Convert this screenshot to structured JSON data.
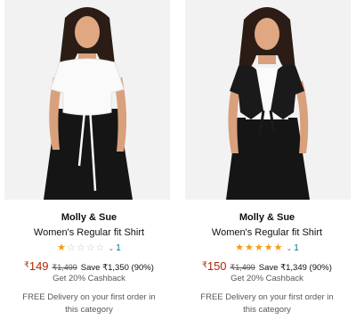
{
  "products": [
    {
      "brand": "Molly & Sue",
      "title": "Women's Regular fit Shirt",
      "rating_stars": 1,
      "rating_max": 5,
      "rating_count": "1",
      "currency_symbol": "₹",
      "price": "149",
      "mrp": "₹1,499",
      "save": "Save ₹1,350 (90%)",
      "cashback": "Get 20% Cashback",
      "delivery": "FREE Delivery on your first order in this category",
      "image_alt": "Model wearing white tie-front crop shrug over black dress"
    },
    {
      "brand": "Molly & Sue",
      "title": "Women's Regular fit Shirt",
      "rating_stars": 5,
      "rating_max": 5,
      "rating_count": "1",
      "currency_symbol": "₹",
      "price": "150",
      "mrp": "₹1,499",
      "save": "Save ₹1,349 (90%)",
      "cashback": "Get 20% Cashback",
      "delivery": "FREE Delivery on your first order in this category",
      "image_alt": "Model wearing black tie-front crop shrug over white top and black skirt"
    }
  ],
  "colors": {
    "price": "#b12704",
    "star_full": "#f39c12",
    "star_empty": "#c8c8c8",
    "link": "#007185",
    "muted": "#565959"
  }
}
